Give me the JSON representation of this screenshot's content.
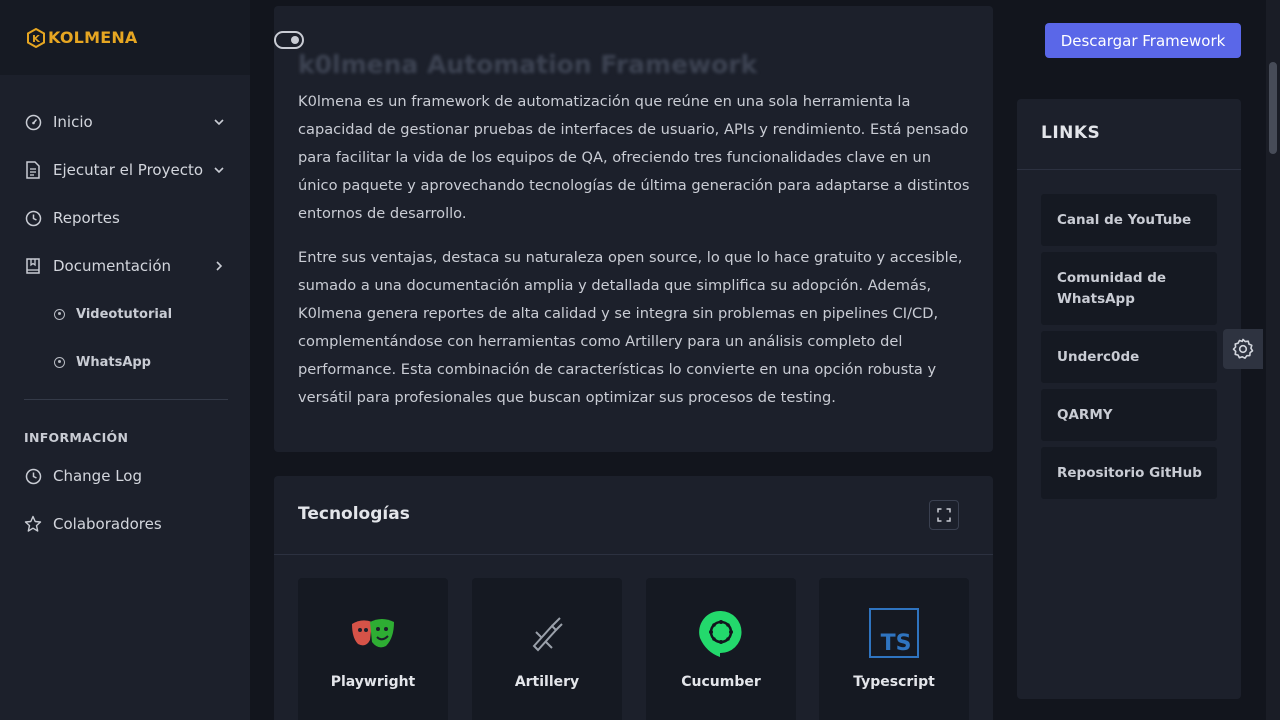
{
  "brand": {
    "name": "KOLMENA"
  },
  "topbar": {
    "download_label": "Descargar Framework"
  },
  "sidebar": {
    "items": [
      {
        "label": "Inicio",
        "icon": "gauge-icon"
      },
      {
        "label": "Ejecutar el Proyecto",
        "icon": "document-icon"
      },
      {
        "label": "Reportes",
        "icon": "clock-icon"
      },
      {
        "label": "Documentación",
        "icon": "book-icon"
      }
    ],
    "sub_items": [
      {
        "label": "Videotutorial"
      },
      {
        "label": "WhatsApp"
      }
    ],
    "section_title": "INFORMACIÓN",
    "info_items": [
      {
        "label": "Change Log",
        "icon": "clock-icon"
      },
      {
        "label": "Colaboradores",
        "icon": "star-icon"
      }
    ]
  },
  "about": {
    "title": "k0lmena Automation Framework",
    "paragraph1": "K0lmena es un framework de automatización que reúne en una sola herramienta la capacidad de gestionar pruebas de interfaces de usuario, APIs y rendimiento. Está pensado para facilitar la vida de los equipos de QA, ofreciendo tres funcionalidades clave en un único paquete y aprovechando tecnologías de última generación para adaptarse a distintos entornos de desarrollo.",
    "paragraph2": "Entre sus ventajas, destaca su naturaleza open source, lo que lo hace gratuito y accesible, sumado a una documentación amplia y detallada que simplifica su adopción. Además, K0lmena genera reportes de alta calidad y se integra sin problemas en pipelines CI/CD, complementándose con herramientas como Artillery para un análisis completo del performance. Esta combinación de características lo convierte en una opción robusta y versátil para profesionales que buscan optimizar sus procesos de testing."
  },
  "tech": {
    "title": "Tecnologías",
    "items": [
      {
        "name": "Playwright",
        "icon": "playwright-icon"
      },
      {
        "name": "Artillery",
        "icon": "artillery-icon"
      },
      {
        "name": "Cucumber",
        "icon": "cucumber-icon"
      },
      {
        "name": "Typescript",
        "icon": "typescript-icon"
      }
    ]
  },
  "links": {
    "title": "LINKS",
    "items": [
      {
        "label": "Canal de YouTube"
      },
      {
        "label": "Comunidad de WhatsApp"
      },
      {
        "label": "Underc0de"
      },
      {
        "label": "QARMY"
      },
      {
        "label": "Repositorio GitHub"
      }
    ]
  },
  "colors": {
    "accent": "#5a67e8",
    "brand": "#e6a622",
    "background": "#12151d",
    "card": "#1c202b"
  }
}
